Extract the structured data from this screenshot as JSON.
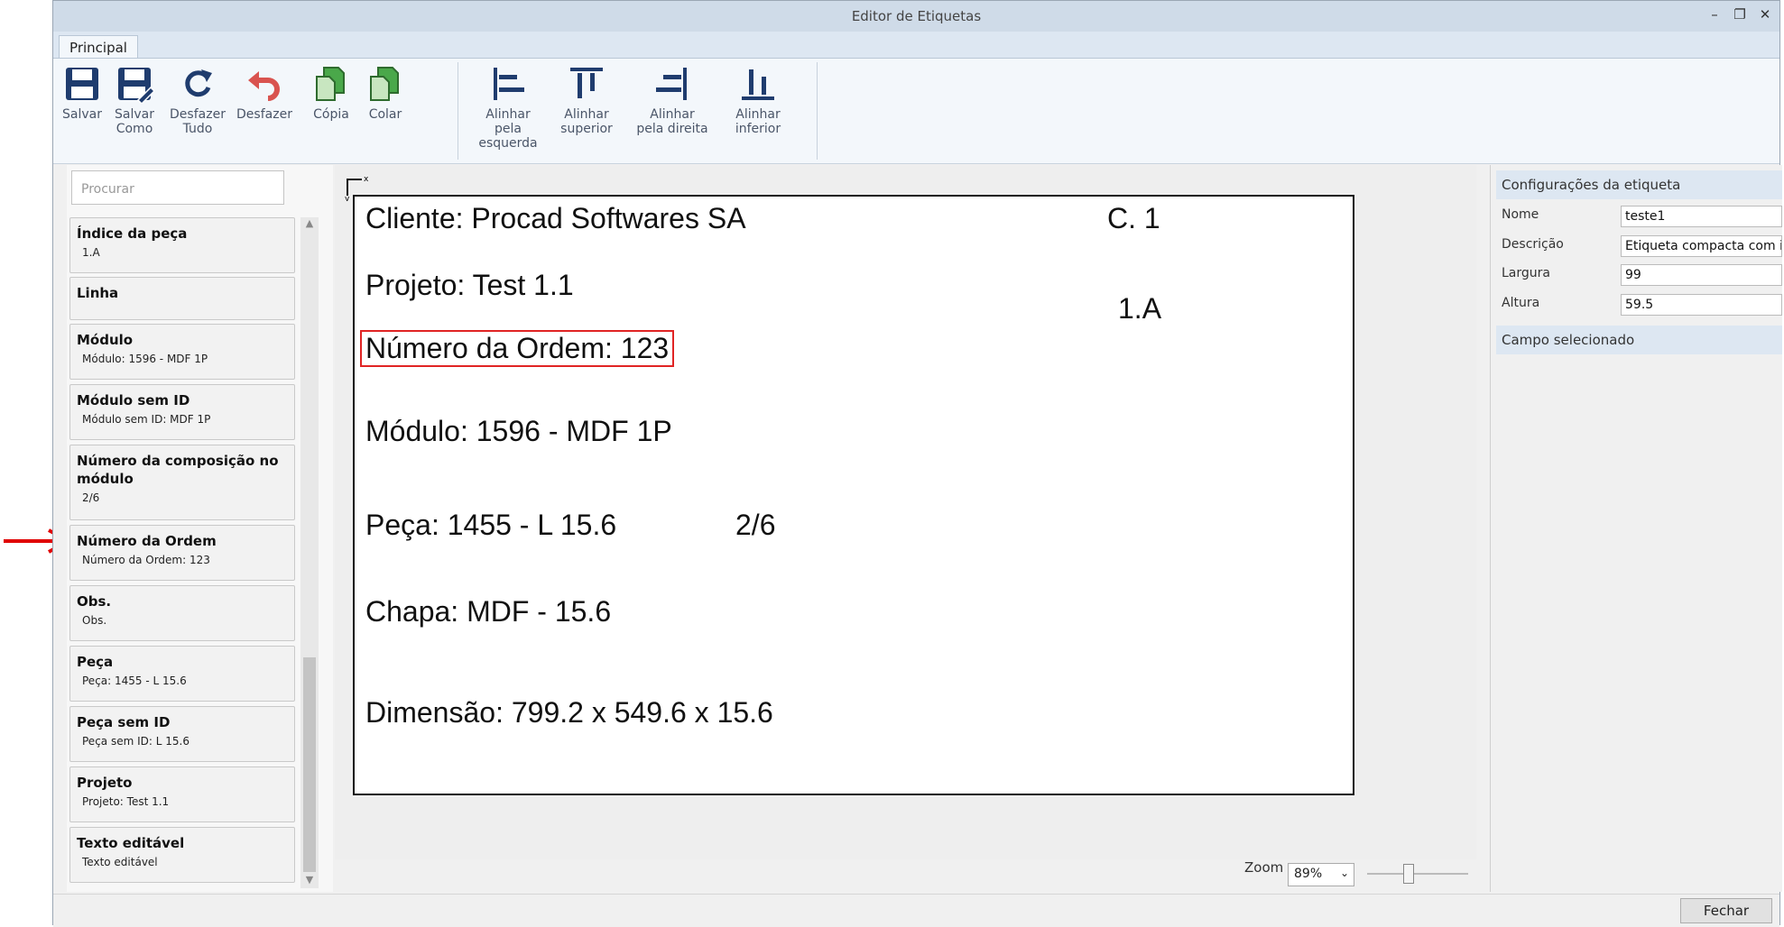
{
  "window": {
    "title": "Editor de Etiquetas"
  },
  "ribbon": {
    "tab": "Principal",
    "buttons": {
      "salvar": "Salvar",
      "salvar_como_1": "Salvar",
      "salvar_como_2": "Como",
      "desfazer_tudo_1": "Desfazer",
      "desfazer_tudo_2": "Tudo",
      "desfazer": "Desfazer",
      "copia": "Cópia",
      "colar": "Colar",
      "alinhar_esq_1": "Alinhar",
      "alinhar_esq_2": "pela esquerda",
      "alinhar_sup_1": "Alinhar",
      "alinhar_sup_2": "superior",
      "alinhar_dir_1": "Alinhar",
      "alinhar_dir_2": "pela direita",
      "alinhar_inf_1": "Alinhar",
      "alinhar_inf_2": "inferior"
    }
  },
  "left": {
    "search_placeholder": "Procurar",
    "items": [
      {
        "title": "Índice da peça",
        "sub": "1.A"
      },
      {
        "title": "Linha",
        "sub": ""
      },
      {
        "title": "Módulo",
        "sub": "Módulo: 1596 - MDF 1P"
      },
      {
        "title": "Módulo sem ID",
        "sub": "Módulo sem ID: MDF 1P"
      },
      {
        "title": "Número da composição no módulo",
        "sub": "2/6"
      },
      {
        "title": "Número da Ordem",
        "sub": "Número da Ordem: 123"
      },
      {
        "title": "Obs.",
        "sub": "Obs."
      },
      {
        "title": "Peça",
        "sub": "Peça: 1455 - L 15.6"
      },
      {
        "title": "Peça sem ID",
        "sub": "Peça sem ID: L 15.6"
      },
      {
        "title": "Projeto",
        "sub": "Projeto: Test 1.1"
      },
      {
        "title": "Texto editável",
        "sub": "Texto editável"
      }
    ]
  },
  "label": {
    "cliente": "Cliente: Procad Softwares SA",
    "c1": "C. 1",
    "projeto": "Projeto: Test 1.1",
    "indice": "1.A",
    "ordem": "Número da Ordem: 123",
    "modulo": "Módulo: 1596 - MDF 1P",
    "peca": "Peça: 1455 - L 15.6",
    "composicao": "2/6",
    "chapa": "Chapa: MDF - 15.6",
    "dimensao": "Dimensão: 799.2 x 549.6 x 15.6"
  },
  "zoom": {
    "label": "Zoom",
    "value": "89%",
    "level_percent": 40
  },
  "right": {
    "section1": "Configurações da etiqueta",
    "nome_label": "Nome",
    "nome_value": "teste1",
    "descricao_label": "Descrição",
    "descricao_value": "Etiqueta compacta com informações",
    "largura_label": "Largura",
    "largura_value": "99",
    "altura_label": "Altura",
    "altura_value": "59.5",
    "section2": "Campo selecionado"
  },
  "footer": {
    "close": "Fechar"
  },
  "colors": {
    "accent": "#dde7f2",
    "selection": "#e02424",
    "annotation_arrow": "#e00000"
  }
}
